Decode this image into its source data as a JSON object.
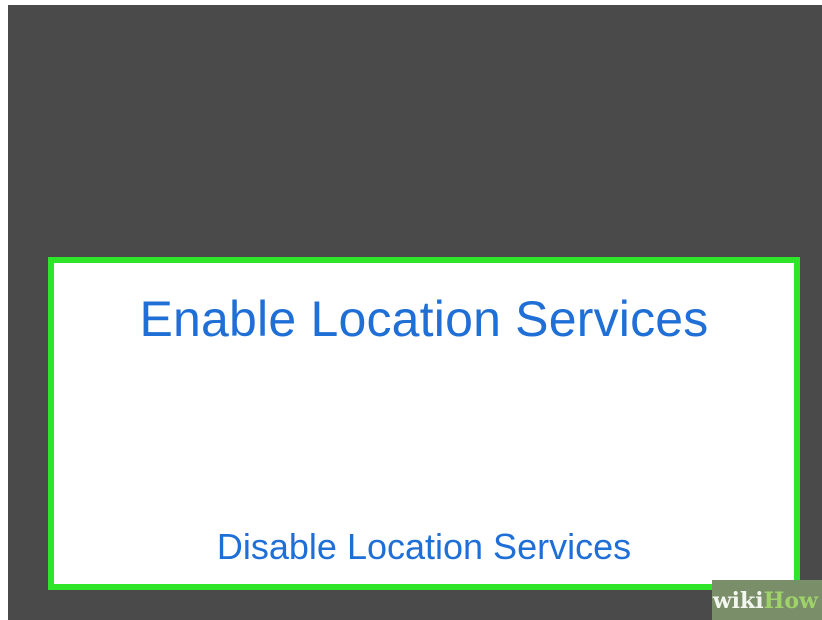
{
  "actions": {
    "enable_label": "Enable Location Services",
    "disable_label": "Disable Location Services"
  },
  "watermark": {
    "wiki": "wiki",
    "how": "How"
  },
  "colors": {
    "background": "#4a4a4a",
    "highlight_border": "#2ee52a",
    "action_text": "#1f6fd6",
    "sheet": "#ffffff"
  }
}
